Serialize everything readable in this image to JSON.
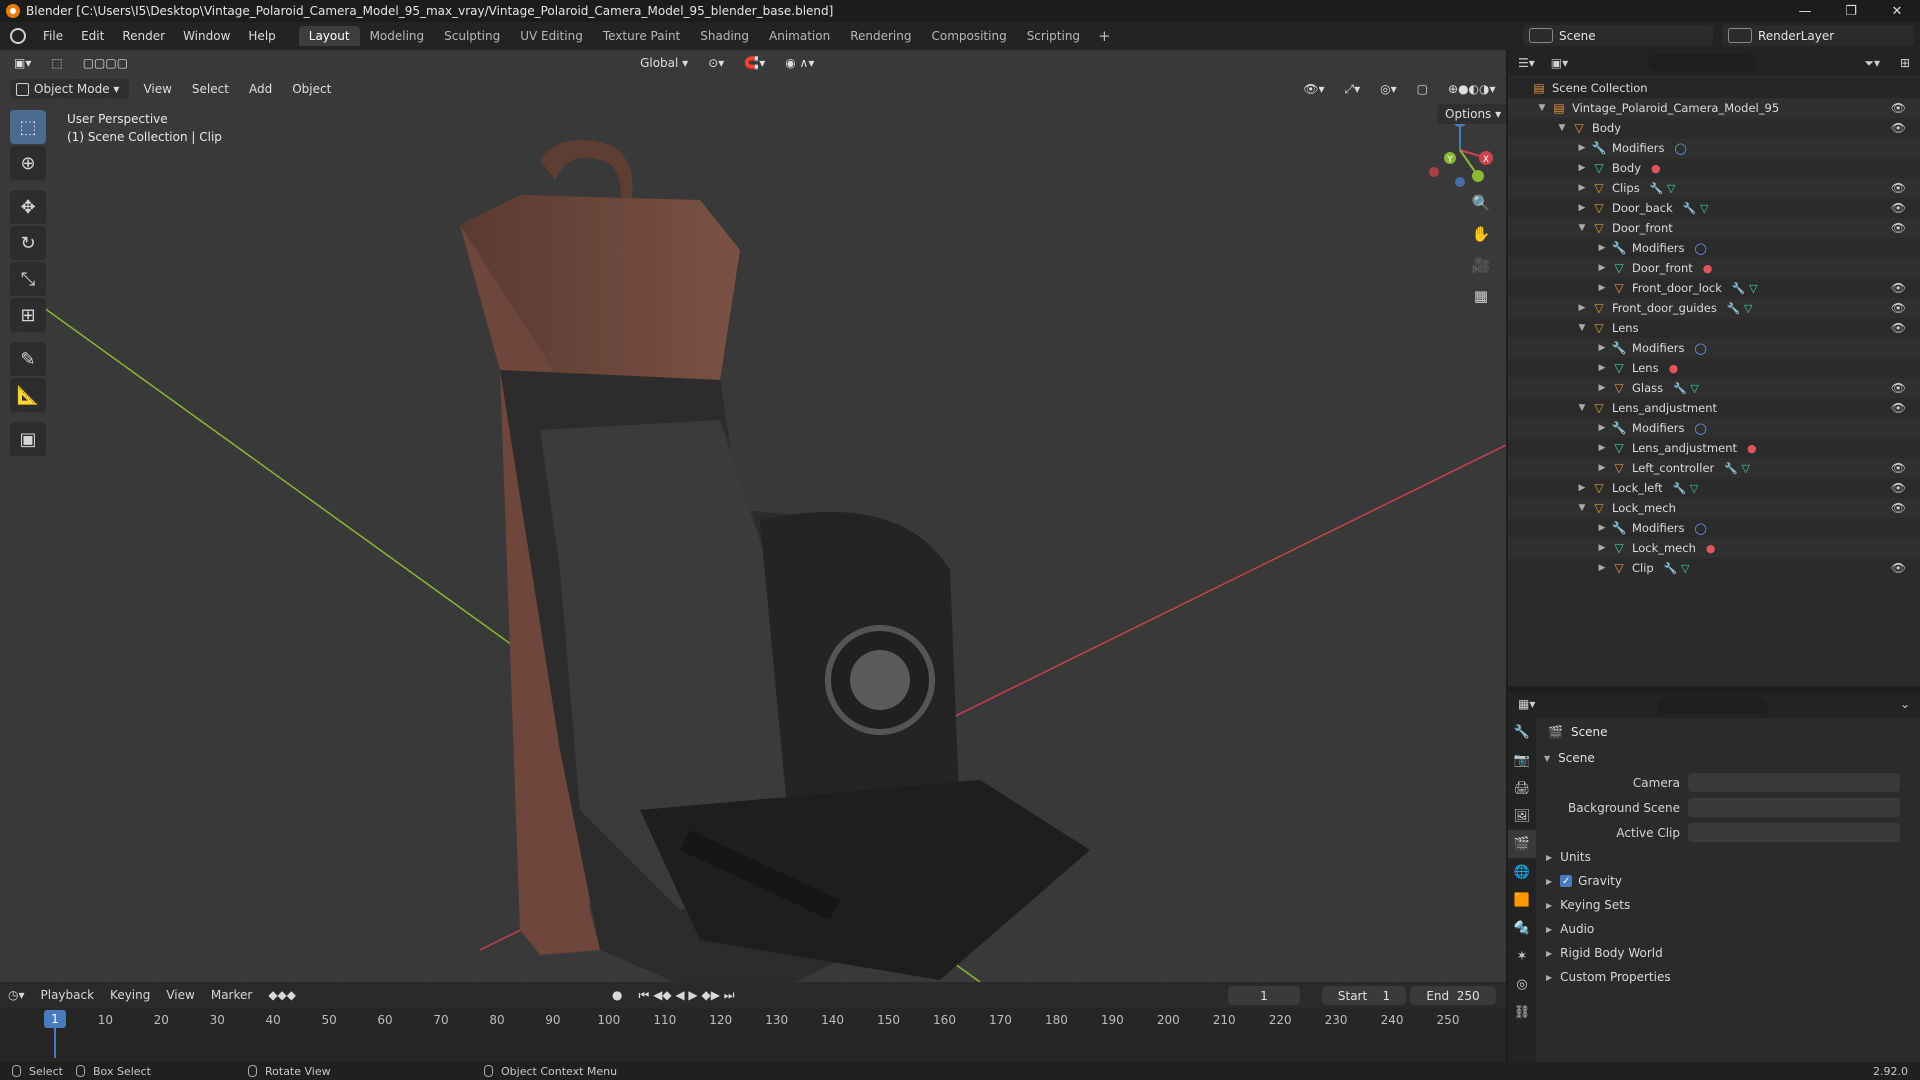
{
  "window": {
    "title": "Blender [C:\\Users\\I5\\Desktop\\Vintage_Polaroid_Camera_Model_95_max_vray/Vintage_Polaroid_Camera_Model_95_blender_base.blend]"
  },
  "menu": [
    "File",
    "Edit",
    "Render",
    "Window",
    "Help"
  ],
  "workspaces": [
    "Layout",
    "Modeling",
    "Sculpting",
    "UV Editing",
    "Texture Paint",
    "Shading",
    "Animation",
    "Rendering",
    "Compositing",
    "Scripting"
  ],
  "active_workspace": "Layout",
  "scene_selector": "Scene",
  "layer_selector": "RenderLayer",
  "viewport": {
    "mode": "Object Mode",
    "menus": [
      "View",
      "Select",
      "Add",
      "Object"
    ],
    "transform_orientation": "Global",
    "options": "Options",
    "overlay_line1": "User Perspective",
    "overlay_line2": "(1) Scene Collection | Clip",
    "gizmo": {
      "x": "X",
      "y": "Y",
      "z": "Z"
    }
  },
  "timeline": {
    "menus": [
      "Playback",
      "Keying",
      "View",
      "Marker"
    ],
    "current_frame": "1",
    "start_label": "Start",
    "start": "1",
    "end_label": "End",
    "end": "250",
    "ticks": [
      "1",
      "10",
      "20",
      "30",
      "40",
      "50",
      "60",
      "70",
      "80",
      "90",
      "100",
      "110",
      "120",
      "130",
      "140",
      "150",
      "160",
      "170",
      "180",
      "190",
      "200",
      "210",
      "220",
      "230",
      "240",
      "250"
    ]
  },
  "statusbar": {
    "select": "Select",
    "box_select": "Box Select",
    "rotate_view": "Rotate View",
    "context_menu": "Object Context Menu",
    "version": "2.92.0"
  },
  "outliner": {
    "rows": [
      {
        "label": "Scene Collection",
        "kind": "collection",
        "indent": 0,
        "arrow": "",
        "eye": false
      },
      {
        "label": "Vintage_Polaroid_Camera_Model_95",
        "kind": "collection",
        "indent": 1,
        "arrow": "▼",
        "eye": true
      },
      {
        "label": "Body",
        "kind": "object",
        "indent": 2,
        "arrow": "▼",
        "eye": true
      },
      {
        "label": "Modifiers",
        "kind": "modifier",
        "indent": 3,
        "arrow": "▶",
        "eye": false,
        "extra": "mod"
      },
      {
        "label": "Body",
        "kind": "mesh",
        "indent": 3,
        "arrow": "▶",
        "eye": false,
        "extra": "mat"
      },
      {
        "label": "Clips",
        "kind": "object",
        "indent": 3,
        "arrow": "▶",
        "eye": true,
        "extra": "both"
      },
      {
        "label": "Door_back",
        "kind": "object",
        "indent": 3,
        "arrow": "▶",
        "eye": true,
        "extra": "both"
      },
      {
        "label": "Door_front",
        "kind": "object",
        "indent": 3,
        "arrow": "▼",
        "eye": true
      },
      {
        "label": "Modifiers",
        "kind": "modifier",
        "indent": 4,
        "arrow": "▶",
        "eye": false,
        "extra": "mod"
      },
      {
        "label": "Door_front",
        "kind": "mesh",
        "indent": 4,
        "arrow": "▶",
        "eye": false,
        "extra": "mat"
      },
      {
        "label": "Front_door_lock",
        "kind": "object",
        "indent": 4,
        "arrow": "▶",
        "eye": true,
        "extra": "both"
      },
      {
        "label": "Front_door_guides",
        "kind": "object",
        "indent": 3,
        "arrow": "▶",
        "eye": true,
        "extra": "both"
      },
      {
        "label": "Lens",
        "kind": "object",
        "indent": 3,
        "arrow": "▼",
        "eye": true
      },
      {
        "label": "Modifiers",
        "kind": "modifier",
        "indent": 4,
        "arrow": "▶",
        "eye": false,
        "extra": "mod"
      },
      {
        "label": "Lens",
        "kind": "mesh",
        "indent": 4,
        "arrow": "▶",
        "eye": false,
        "extra": "mat"
      },
      {
        "label": "Glass",
        "kind": "object",
        "indent": 4,
        "arrow": "▶",
        "eye": true,
        "extra": "both"
      },
      {
        "label": "Lens_andjustment",
        "kind": "object",
        "indent": 3,
        "arrow": "▼",
        "eye": true
      },
      {
        "label": "Modifiers",
        "kind": "modifier",
        "indent": 4,
        "arrow": "▶",
        "eye": false,
        "extra": "mod"
      },
      {
        "label": "Lens_andjustment",
        "kind": "mesh",
        "indent": 4,
        "arrow": "▶",
        "eye": false,
        "extra": "mat"
      },
      {
        "label": "Left_controller",
        "kind": "object",
        "indent": 4,
        "arrow": "▶",
        "eye": true,
        "extra": "both"
      },
      {
        "label": "Lock_left",
        "kind": "object",
        "indent": 3,
        "arrow": "▶",
        "eye": true,
        "extra": "both"
      },
      {
        "label": "Lock_mech",
        "kind": "object",
        "indent": 3,
        "arrow": "▼",
        "eye": true
      },
      {
        "label": "Modifiers",
        "kind": "modifier",
        "indent": 4,
        "arrow": "▶",
        "eye": false,
        "extra": "mod"
      },
      {
        "label": "Lock_mech",
        "kind": "mesh",
        "indent": 4,
        "arrow": "▶",
        "eye": false,
        "extra": "mat"
      },
      {
        "label": "Clip",
        "kind": "object",
        "indent": 4,
        "arrow": "▶",
        "eye": true,
        "extra": "both"
      }
    ]
  },
  "properties": {
    "context": "Scene",
    "panel": "Scene",
    "fields": [
      {
        "label": "Camera"
      },
      {
        "label": "Background Scene"
      },
      {
        "label": "Active Clip"
      }
    ],
    "subpanels": [
      "Units",
      "Gravity",
      "Keying Sets",
      "Audio",
      "Rigid Body World",
      "Custom Properties"
    ],
    "gravity_checked": true
  },
  "colors": {
    "accent_blue": "#4b7bbf",
    "object_orange": "#e8953a",
    "mesh_green": "#3fd1a0",
    "material_red": "#e0555b",
    "x_axis_red": "#c8434c",
    "y_axis_green": "#8ab833"
  }
}
